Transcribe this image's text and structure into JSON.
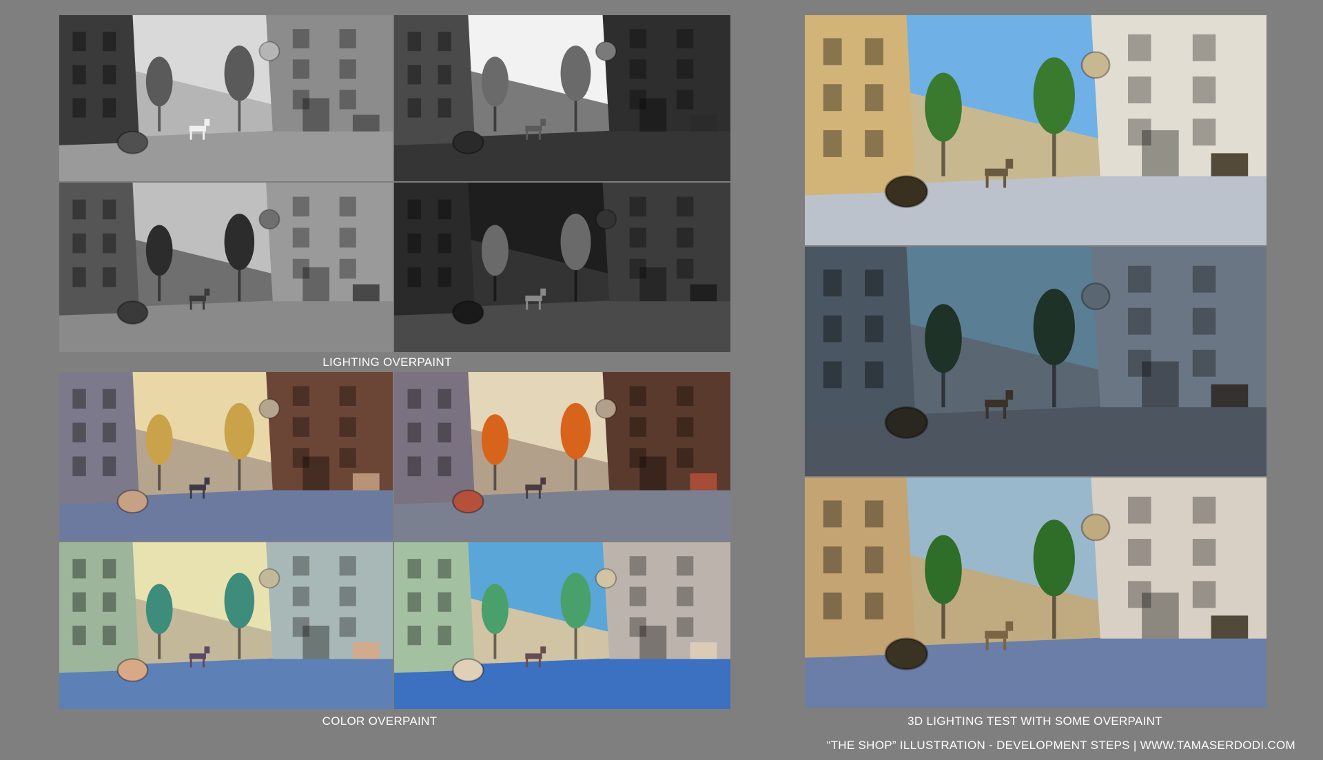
{
  "captions": {
    "lighting_overpaint": "LIGHTING OVERPAINT",
    "color_overpaint": "COLOR OVERPAINT",
    "lighting_test_3d": "3D LIGHTING TEST WITH SOME OVERPAINT",
    "footer": "“THE SHOP” ILLUSTRATION - DEVELOPMENT STEPS | WWW.TAMASERDODI.COM"
  },
  "panels": [
    {
      "name": "grayscale-study-day",
      "palette": {
        "sky": "#d9d9d9",
        "left": "#3a3a3a",
        "right": "#8c8c8c",
        "street": "#9a9a9a",
        "tree": "#5a5a5a",
        "barrel": "#505050",
        "dog": "#f0f0f0",
        "mid": "#b5b5b5"
      }
    },
    {
      "name": "grayscale-study-backlit",
      "palette": {
        "sky": "#f2f2f2",
        "left": "#4a4a4a",
        "right": "#2e2e2e",
        "street": "#353535",
        "tree": "#6a6a6a",
        "barrel": "#2a2a2a",
        "dog": "#5a5a5a",
        "mid": "#7a7a7a"
      }
    },
    {
      "name": "grayscale-study-clouds",
      "palette": {
        "sky": "#bfbfbf",
        "left": "#555555",
        "right": "#9a9a9a",
        "street": "#8a8a8a",
        "tree": "#2c2c2c",
        "barrel": "#3a3a3a",
        "dog": "#3a3a3a",
        "mid": "#6f6f6f"
      }
    },
    {
      "name": "grayscale-study-night",
      "palette": {
        "sky": "#1e1e1e",
        "left": "#2a2a2a",
        "right": "#3c3c3c",
        "street": "#4a4a4a",
        "tree": "#6a6a6a",
        "barrel": "#1a1a1a",
        "dog": "#8a8a8a",
        "mid": "#333333"
      }
    },
    {
      "name": "color-study-warm-sunlight",
      "palette": {
        "sky": "#e9d7a8",
        "left": "#7c7a8a",
        "right": "#6b4636",
        "street": "#6d7aa0",
        "tree": "#c9a24a",
        "barrel": "#c7a184",
        "dog": "#3d3a48",
        "mid": "#b6a58e"
      }
    },
    {
      "name": "color-study-autumn",
      "palette": {
        "sky": "#e4d6b8",
        "left": "#7a7280",
        "right": "#5a3a2c",
        "street": "#7a8090",
        "tree": "#d8641c",
        "barrel": "#b5503a",
        "dog": "#4a3c40",
        "mid": "#b3a08a"
      }
    },
    {
      "name": "color-study-teal-trees",
      "palette": {
        "sky": "#e8e2b0",
        "left": "#9db59a",
        "right": "#a8b8b6",
        "street": "#5d80b6",
        "tree": "#3e8c7c",
        "barrel": "#d9a886",
        "dog": "#5a4a66",
        "mid": "#c4b89a"
      }
    },
    {
      "name": "color-study-blue-sky",
      "palette": {
        "sky": "#5aa6d8",
        "left": "#a3c0a0",
        "right": "#bcb4ac",
        "street": "#3c70c0",
        "tree": "#4aa06a",
        "barrel": "#e0d0b8",
        "dog": "#6a4c50",
        "mid": "#d0c4a4"
      }
    },
    {
      "name": "render-3d-daylight",
      "palette": {
        "sky": "#6fb0e6",
        "left": "#d2b478",
        "right": "#e2ddd2",
        "street": "#bcc2cc",
        "tree": "#3a7a2e",
        "barrel": "#3a3020",
        "dog": "#6a5a40",
        "mid": "#c8b890"
      }
    },
    {
      "name": "render-3d-dusk",
      "palette": {
        "sky": "#5a7e94",
        "left": "#4a5662",
        "right": "#6a7684",
        "street": "#4c5560",
        "tree": "#1e3228",
        "barrel": "#2a2620",
        "dog": "#3a3228",
        "mid": "#5a6672"
      }
    },
    {
      "name": "render-3d-overpaint",
      "palette": {
        "sky": "#9ab8cc",
        "left": "#c4a472",
        "right": "#d8d0c4",
        "street": "#6a7ea8",
        "tree": "#2e6e28",
        "barrel": "#3a3222",
        "dog": "#7a6446",
        "mid": "#c0aa80"
      }
    }
  ]
}
